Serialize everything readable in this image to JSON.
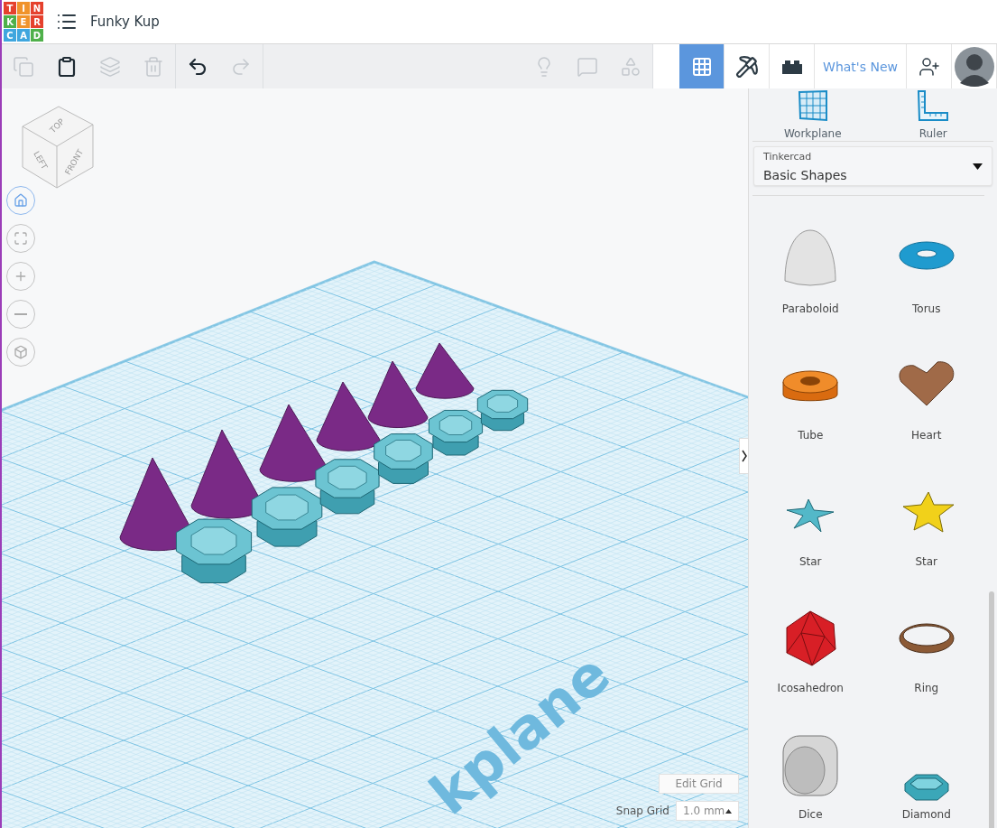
{
  "logo": {
    "letters": [
      {
        "char": "T",
        "color": "#e5412d"
      },
      {
        "char": "I",
        "color": "#f0932b"
      },
      {
        "char": "N",
        "color": "#e5412d"
      },
      {
        "char": "K",
        "color": "#4fb04a"
      },
      {
        "char": "E",
        "color": "#f0932b"
      },
      {
        "char": "R",
        "color": "#e5412d"
      },
      {
        "char": "C",
        "color": "#3fa6de"
      },
      {
        "char": "A",
        "color": "#3fa6de"
      },
      {
        "char": "D",
        "color": "#4fb04a"
      }
    ]
  },
  "document": {
    "title": "Funky Kup"
  },
  "toolbar": [
    {
      "kind": "copy",
      "disabled": true
    },
    {
      "kind": "paste",
      "disabled": false
    },
    {
      "kind": "duplicate",
      "disabled": true
    },
    {
      "kind": "delete",
      "disabled": true
    },
    {
      "kind": "undo",
      "disabled": false
    },
    {
      "kind": "redo",
      "disabled": true
    },
    {
      "kind": "hint",
      "disabled": true
    },
    {
      "kind": "notes",
      "disabled": true
    },
    {
      "kind": "show",
      "disabled": true
    }
  ],
  "views": [
    {
      "kind": "design",
      "selected": true
    },
    {
      "kind": "blocks",
      "selected": false
    },
    {
      "kind": "bricks",
      "selected": false
    }
  ],
  "whats_new": "What's New",
  "view_cube": {
    "top": "TOP",
    "left": "LEFT",
    "front": "FRONT"
  },
  "nav_controls": [
    {
      "kind": "home"
    },
    {
      "kind": "fit"
    },
    {
      "kind": "zoom-in"
    },
    {
      "kind": "zoom-out"
    },
    {
      "kind": "perspective"
    }
  ],
  "workplane_label": "kplane",
  "grid": {
    "edit_button": "Edit Grid",
    "snap_label": "Snap Grid",
    "snap_value": "1.0 mm"
  },
  "panel": {
    "tools": [
      {
        "kind": "workplane",
        "label": "Workplane"
      },
      {
        "kind": "ruler",
        "label": "Ruler"
      }
    ],
    "library": {
      "caption": "Tinkercad",
      "value": "Basic Shapes"
    },
    "shapes": [
      {
        "kind": "paraboloid",
        "label": "Paraboloid"
      },
      {
        "kind": "torus",
        "label": "Torus"
      },
      {
        "kind": "tube",
        "label": "Tube"
      },
      {
        "kind": "heart",
        "label": "Heart"
      },
      {
        "kind": "star-thin",
        "label": "Star"
      },
      {
        "kind": "star",
        "label": "Star"
      },
      {
        "kind": "icosahedron",
        "label": "Icosahedron"
      },
      {
        "kind": "ring",
        "label": "Ring"
      },
      {
        "kind": "dice",
        "label": "Dice"
      },
      {
        "kind": "diamond",
        "label": "Diamond"
      }
    ]
  }
}
